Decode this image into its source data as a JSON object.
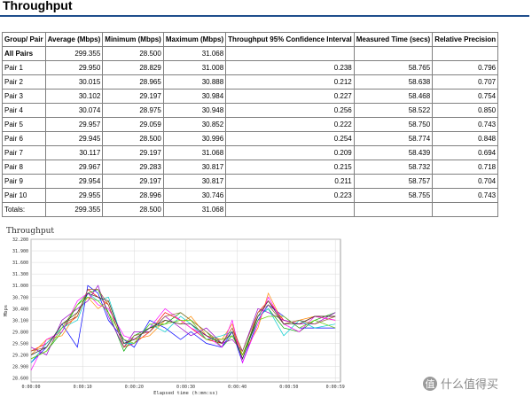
{
  "page_title": "Throughput",
  "table": {
    "headers": [
      "Group/ Pair",
      "Average (Mbps)",
      "Minimum (Mbps)",
      "Maximum (Mbps)",
      "Throughput 95% Confidence Interval",
      "Measured Time (secs)",
      "Relative Precision"
    ],
    "rows": [
      [
        "All Pairs",
        "299.355",
        "28.500",
        "31.068",
        "",
        "",
        ""
      ],
      [
        "Pair 1",
        "29.950",
        "28.829",
        "31.008",
        "0.238",
        "58.765",
        "0.796"
      ],
      [
        "Pair 2",
        "30.015",
        "28.965",
        "30.888",
        "0.212",
        "58.638",
        "0.707"
      ],
      [
        "Pair 3",
        "30.102",
        "29.197",
        "30.984",
        "0.227",
        "58.468",
        "0.754"
      ],
      [
        "Pair 4",
        "30.074",
        "28.975",
        "30.948",
        "0.256",
        "58.522",
        "0.850"
      ],
      [
        "Pair 5",
        "29.957",
        "29.059",
        "30.852",
        "0.222",
        "58.750",
        "0.743"
      ],
      [
        "Pair 6",
        "29.945",
        "28.500",
        "30.996",
        "0.254",
        "58.774",
        "0.848"
      ],
      [
        "Pair 7",
        "30.117",
        "29.197",
        "31.068",
        "0.209",
        "58.439",
        "0.694"
      ],
      [
        "Pair 8",
        "29.967",
        "29.283",
        "30.817",
        "0.215",
        "58.732",
        "0.718"
      ],
      [
        "Pair 9",
        "29.954",
        "29.197",
        "30.817",
        "0.211",
        "58.757",
        "0.704"
      ],
      [
        "Pair 10",
        "29.955",
        "28.996",
        "30.746",
        "0.223",
        "58.755",
        "0.743"
      ],
      [
        "Totals:",
        "299.355",
        "28.500",
        "31.068",
        "",
        "",
        ""
      ]
    ]
  },
  "chart_data": {
    "type": "line",
    "title": "Throughput",
    "xlabel": "Elapsed time (h:mm:ss)",
    "ylabel": "Mbps",
    "ylim": [
      28.5,
      32.2
    ],
    "xlim": [
      0,
      60
    ],
    "y_ticks": [
      "32.200",
      "31.900",
      "31.600",
      "31.300",
      "31.000",
      "30.700",
      "30.400",
      "30.100",
      "29.800",
      "29.500",
      "29.200",
      "28.900",
      "28.600"
    ],
    "x_ticks": [
      {
        "t": 0,
        "label": "0:00:00"
      },
      {
        "t": 10,
        "label": "0:00:10"
      },
      {
        "t": 20,
        "label": "0:00:20"
      },
      {
        "t": 30,
        "label": "0:00:30"
      },
      {
        "t": 40,
        "label": "0:00:40"
      },
      {
        "t": 50,
        "label": "0:00:50"
      },
      {
        "t": 59,
        "label": "0:00:59"
      }
    ],
    "grid": true,
    "x": [
      0,
      3,
      6,
      9,
      11,
      13,
      15,
      18,
      20,
      23,
      26,
      29,
      31,
      34,
      37,
      39,
      41,
      44,
      46,
      49,
      52,
      55,
      59
    ],
    "series": [
      {
        "color": "#ff0000",
        "values": [
          29.3,
          29.5,
          29.9,
          30.2,
          30.9,
          30.7,
          30.5,
          29.4,
          29.5,
          29.8,
          30.3,
          30.1,
          29.9,
          29.6,
          29.5,
          29.9,
          29.1,
          30.3,
          30.6,
          30.1,
          30.0,
          30.2,
          30.2
        ]
      },
      {
        "color": "#00aa00",
        "values": [
          29.1,
          29.3,
          29.8,
          30.5,
          30.8,
          30.9,
          30.3,
          29.3,
          29.7,
          29.9,
          30.0,
          30.3,
          30.1,
          29.8,
          29.4,
          29.7,
          29.2,
          30.2,
          30.4,
          29.9,
          29.8,
          30.1,
          30.3
        ]
      },
      {
        "color": "#0000ff",
        "values": [
          29.0,
          29.4,
          30.0,
          29.4,
          31.0,
          30.8,
          30.1,
          29.6,
          29.4,
          30.1,
          29.9,
          29.6,
          29.8,
          29.5,
          29.4,
          29.8,
          29.0,
          30.1,
          30.5,
          30.2,
          29.9,
          29.9,
          29.9
        ]
      },
      {
        "color": "#ff8800",
        "values": [
          29.2,
          29.6,
          29.7,
          30.3,
          30.7,
          30.4,
          30.6,
          29.5,
          29.6,
          29.7,
          30.1,
          30.0,
          30.2,
          29.7,
          29.6,
          30.0,
          29.2,
          29.9,
          30.8,
          30.0,
          30.1,
          30.2,
          30.1
        ]
      },
      {
        "color": "#9900cc",
        "values": [
          29.4,
          29.2,
          30.1,
          30.4,
          30.6,
          31.0,
          30.2,
          29.4,
          29.8,
          29.8,
          30.2,
          29.9,
          29.7,
          29.9,
          29.5,
          29.6,
          29.3,
          30.4,
          30.3,
          30.1,
          30.0,
          30.0,
          30.3
        ]
      },
      {
        "color": "#00cccc",
        "values": [
          29.0,
          29.5,
          29.9,
          30.1,
          30.8,
          30.6,
          30.7,
          29.5,
          29.5,
          30.0,
          29.8,
          30.2,
          30.0,
          29.6,
          29.7,
          29.8,
          29.1,
          30.2,
          30.4,
          29.7,
          30.1,
          29.9,
          30.0
        ]
      },
      {
        "color": "#ff00ff",
        "values": [
          28.8,
          29.6,
          29.8,
          30.6,
          30.8,
          30.5,
          30.4,
          29.7,
          29.6,
          29.9,
          30.4,
          30.1,
          29.9,
          29.7,
          29.4,
          30.1,
          29.0,
          30.0,
          30.7,
          30.0,
          29.8,
          30.2,
          30.1
        ]
      },
      {
        "color": "#996633",
        "values": [
          29.3,
          29.4,
          30.0,
          30.2,
          30.9,
          30.9,
          30.5,
          29.4,
          29.7,
          29.8,
          30.2,
          30.3,
          30.1,
          29.8,
          29.5,
          29.9,
          29.3,
          30.3,
          30.5,
          30.0,
          30.1,
          30.0,
          30.2
        ]
      },
      {
        "color": "#66cc00",
        "values": [
          29.1,
          29.3,
          29.9,
          30.5,
          30.7,
          30.6,
          30.3,
          29.6,
          29.5,
          30.0,
          30.0,
          30.1,
          30.1,
          29.6,
          29.6,
          29.7,
          29.2,
          30.1,
          30.2,
          30.2,
          29.9,
          30.1,
          29.9
        ]
      },
      {
        "color": "#333333",
        "values": [
          29.2,
          29.4,
          30.0,
          30.3,
          30.8,
          30.7,
          30.6,
          29.5,
          29.6,
          29.9,
          30.1,
          30.0,
          30.0,
          29.7,
          29.5,
          29.8,
          29.1,
          30.2,
          30.6,
          30.0,
          30.0,
          30.2,
          30.2
        ]
      }
    ]
  },
  "watermark": {
    "badge": "值",
    "text": "什么值得买"
  }
}
